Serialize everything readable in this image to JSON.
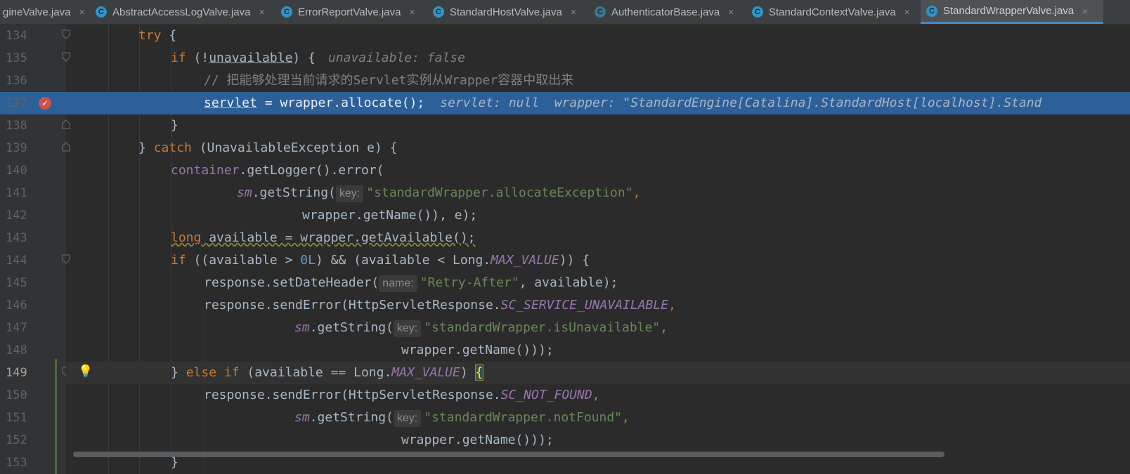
{
  "tabs": [
    {
      "label": "gineValve.java",
      "close": "×",
      "icon": "class-icon"
    },
    {
      "label": "AbstractAccessLogValve.java",
      "close": "×",
      "icon": "class-icon"
    },
    {
      "label": "ErrorReportValve.java",
      "close": "×",
      "icon": "class-icon"
    },
    {
      "label": "StandardHostValve.java",
      "close": "×",
      "icon": "class-icon"
    },
    {
      "label": "AuthenticatorBase.java",
      "close": "×",
      "icon": "abstract-class-icon"
    },
    {
      "label": "StandardContextValve.java",
      "close": "×",
      "icon": "class-icon"
    },
    {
      "label": "StandardWrapperValve.java",
      "close": "×",
      "icon": "class-icon",
      "active": true
    }
  ],
  "tab_icon_letter": "C",
  "editor": {
    "current_line": "149",
    "breakpoint_line": "137",
    "lines": [
      {
        "n": "134"
      },
      {
        "n": "135"
      },
      {
        "n": "136"
      },
      {
        "n": "137"
      },
      {
        "n": "138"
      },
      {
        "n": "139"
      },
      {
        "n": "140"
      },
      {
        "n": "141"
      },
      {
        "n": "142"
      },
      {
        "n": "143"
      },
      {
        "n": "144"
      },
      {
        "n": "145"
      },
      {
        "n": "146"
      },
      {
        "n": "147"
      },
      {
        "n": "148"
      },
      {
        "n": "149"
      },
      {
        "n": "150"
      },
      {
        "n": "151"
      },
      {
        "n": "152"
      },
      {
        "n": "153"
      }
    ],
    "code": {
      "l134": {
        "kw_try": "try",
        "brace": " {"
      },
      "l135": {
        "kw_if": "if",
        "t1": " (!",
        "var": "unavailable",
        "t2": ") {",
        "hint": "unavailable: false"
      },
      "l136": {
        "comment": "// 把能够处理当前请求的Servlet实例从Wrapper容器中取出来"
      },
      "l137": {
        "var": "servlet",
        "t1": " = wrapper.allocate();",
        "hint": "servlet: null  wrapper: \"StandardEngine[Catalina].StandardHost[localhost].Stand"
      },
      "l138": {
        "t1": "}"
      },
      "l139": {
        "t1": "} ",
        "kw_catch": "catch",
        "t2": " (UnavailableException e) {"
      },
      "l140": {
        "field": "container",
        "t1": ".getLogger().error("
      },
      "l141": {
        "stat": "sm",
        "t1": ".getString(",
        "param": "key:",
        "str": "\"standardWrapper.allocateException\"",
        "t2": ","
      },
      "l142": {
        "t1": "wrapper.getName()), e);"
      },
      "l143": {
        "kw_long": "long",
        "t1": " available = wrapper.getAvailable();"
      },
      "l144": {
        "kw_if": "if",
        "t1": " ((available > ",
        "num": "0L",
        "t2": ") && (available < Long.",
        "stat": "MAX_VALUE",
        "t3": ")) {"
      },
      "l145": {
        "t1": "response.setDateHeader(",
        "param": "name:",
        "str": "\"Retry-After\"",
        "t2": ", available);"
      },
      "l146": {
        "t1": "response.sendError(HttpServletResponse.",
        "stat": "SC_SERVICE_UNAVAILABLE",
        "t2": ","
      },
      "l147": {
        "stat": "sm",
        "t1": ".getString(",
        "param": "key:",
        "str": "\"standardWrapper.isUnavailable\"",
        "t2": ","
      },
      "l148": {
        "t1": "wrapper.getName()));"
      },
      "l149": {
        "t0": "} ",
        "kw_else": "else if",
        "t1": " (available == Long.",
        "stat": "MAX_VALUE",
        "t2": ") ",
        "brace": "{"
      },
      "l150": {
        "t1": "response.sendError(HttpServletResponse.",
        "stat": "SC_NOT_FOUND",
        "t2": ","
      },
      "l151": {
        "stat": "sm",
        "t1": ".getString(",
        "param": "key:",
        "str": "\"standardWrapper.notFound\"",
        "t2": ","
      },
      "l152": {
        "t1": "wrapper.getName()));"
      },
      "l153": {
        "t1": "}"
      }
    }
  },
  "colors": {
    "keyword": "#cc7832",
    "string": "#6a8759",
    "number": "#6897bb",
    "comment": "#808080",
    "field": "#9876aa",
    "default": "#a9b7c6",
    "execution_line": "#2d6099",
    "breakpoint": "#c75450",
    "accent": "#4a88c7"
  }
}
